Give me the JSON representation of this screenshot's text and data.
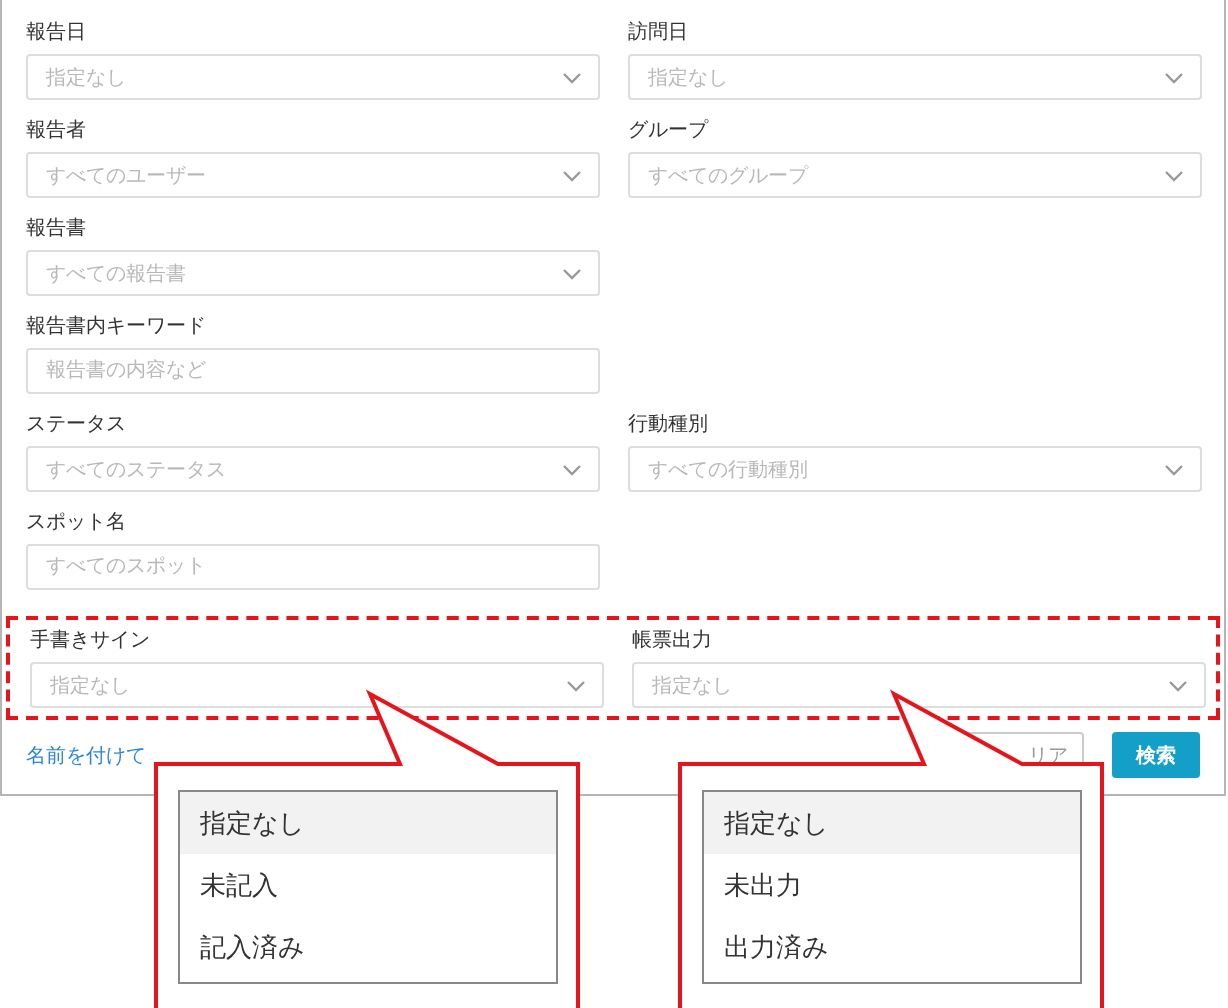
{
  "rows": [
    {
      "highlighted": false,
      "fields": [
        {
          "label": "報告日",
          "kind": "select",
          "placeholder": "指定なし"
        },
        {
          "label": "訪問日",
          "kind": "select",
          "placeholder": "指定なし"
        }
      ]
    },
    {
      "highlighted": false,
      "fields": [
        {
          "label": "報告者",
          "kind": "select",
          "placeholder": "すべてのユーザー"
        },
        {
          "label": "グループ",
          "kind": "select",
          "placeholder": "すべてのグループ"
        }
      ]
    },
    {
      "highlighted": false,
      "fields": [
        {
          "label": "報告書",
          "kind": "select",
          "placeholder": "すべての報告書"
        }
      ]
    },
    {
      "highlighted": false,
      "fields": [
        {
          "label": "報告書内キーワード",
          "kind": "text",
          "placeholder": "報告書の内容など"
        }
      ]
    },
    {
      "highlighted": false,
      "fields": [
        {
          "label": "ステータス",
          "kind": "select",
          "placeholder": "すべてのステータス"
        },
        {
          "label": "行動種別",
          "kind": "select",
          "placeholder": "すべての行動種別"
        }
      ]
    },
    {
      "highlighted": false,
      "fields": [
        {
          "label": "スポット名",
          "kind": "text",
          "placeholder": "すべてのスポット"
        }
      ]
    },
    {
      "highlighted": true,
      "fields": [
        {
          "label": "手書きサイン",
          "kind": "select",
          "placeholder": "指定なし"
        },
        {
          "label": "帳票出力",
          "kind": "select",
          "placeholder": "指定なし"
        }
      ]
    }
  ],
  "footer": {
    "save_link": "名前を付けて",
    "clear_button": "リア",
    "search_button": "検索"
  },
  "callouts": [
    {
      "options": [
        {
          "label": "指定なし",
          "selected": true
        },
        {
          "label": "未記入",
          "selected": false
        },
        {
          "label": "記入済み",
          "selected": false
        }
      ]
    },
    {
      "options": [
        {
          "label": "指定なし",
          "selected": true
        },
        {
          "label": "未出力",
          "selected": false
        },
        {
          "label": "出力済み",
          "selected": false
        }
      ]
    }
  ]
}
